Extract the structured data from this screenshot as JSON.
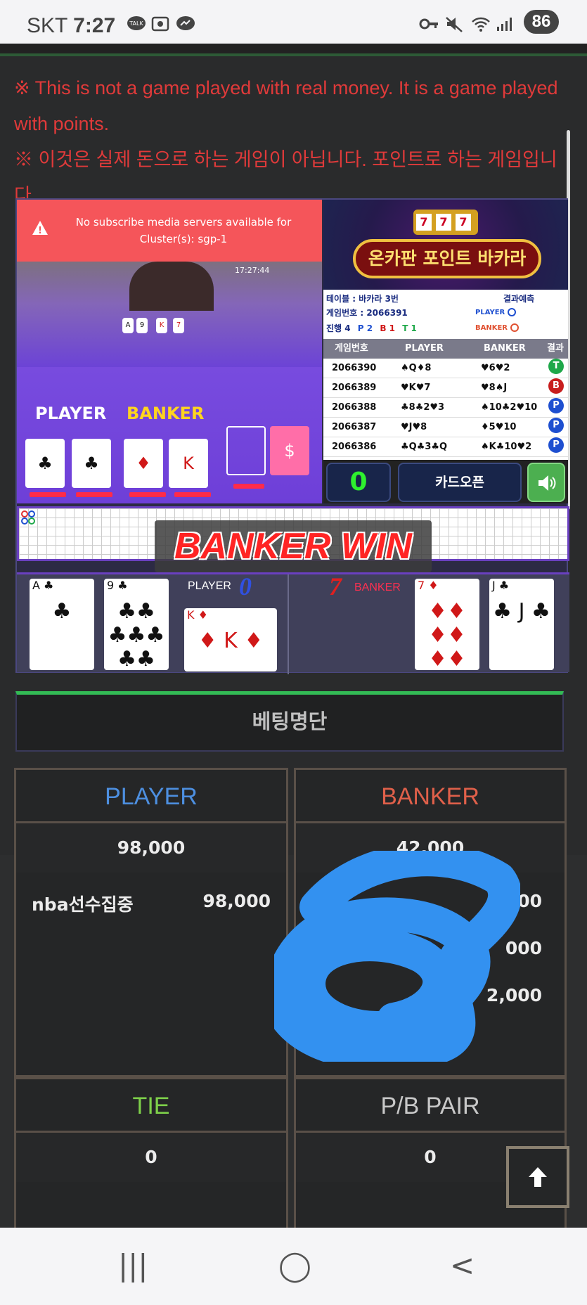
{
  "status_bar": {
    "carrier": "SKT",
    "time": "7:27",
    "battery": "86",
    "left_icons": [
      "talk-icon",
      "screenshot-icon",
      "messenger-icon"
    ],
    "right_icons": [
      "vpn-key-icon",
      "mute-icon",
      "wifi-icon",
      "signal-icon"
    ]
  },
  "notice": {
    "line_en": "※ This is not a game played with real money. It is a game played with points.",
    "line_ko": "※ 이것은 실제 돈으로 하는 게임이 아닙니다. 포인트로 하는 게임입니다."
  },
  "video": {
    "alert": "No subscribe media servers available for Cluster(s): sgp-1",
    "clock": "17:27:44",
    "player_label": "PLAYER",
    "banker_label": "BANKER",
    "table_colors": {
      "felt": "#6e3fd8",
      "stake_red": "#ff2b4a"
    }
  },
  "info_panel": {
    "title": "온카판 포인트 바카라",
    "slot_symbols": [
      "7",
      "7",
      "7"
    ],
    "table_line": "테이블 : 바카라 3번",
    "prediction_label": "결과예측",
    "game_no_line": "게임번호 : 2066391",
    "progress_label": "진행 4",
    "progress_p": "P 2",
    "progress_b": "B 1",
    "progress_t": "T 1",
    "pred_player": "PLAYER",
    "pred_banker": "BANKER",
    "history_headers": [
      "게임번호",
      "PLAYER",
      "BANKER",
      "결과"
    ],
    "history": [
      {
        "id": "2066390",
        "player": "♠Q♦8",
        "banker": "♥6♥2",
        "result": "T",
        "color": "#1fa84a"
      },
      {
        "id": "2066389",
        "player": "♥K♥7",
        "banker": "♥8♠J",
        "result": "B",
        "color": "#c81e1e"
      },
      {
        "id": "2066388",
        "player": "♣8♣2♥3",
        "banker": "♠10♣2♥10",
        "result": "P",
        "color": "#1e4fd0"
      },
      {
        "id": "2066387",
        "player": "♥J♥8",
        "banker": "♦5♥10",
        "result": "P",
        "color": "#1e4fd0"
      },
      {
        "id": "2066386",
        "player": "♣Q♣3♣Q",
        "banker": "♠K♣10♥2",
        "result": "P",
        "color": "#1e4fd0"
      }
    ],
    "counter": "0",
    "card_open_label": "카드오픈",
    "sound_icon": "speaker-icon"
  },
  "result": {
    "win_text": "BANKER WIN",
    "player_label": "PLAYER",
    "player_score": "0",
    "banker_label": "BANKER",
    "banker_score": "7",
    "player_cards": [
      {
        "rank": "A",
        "suit": "♣",
        "pips": "♣"
      },
      {
        "rank": "9",
        "suit": "♣",
        "pips": "♣♣\n♣♣♣\n♣♣"
      },
      {
        "rank": "K",
        "suit": "♦",
        "pips": "♦ K ♦"
      }
    ],
    "banker_cards": [
      {
        "rank": "7",
        "suit": "♦",
        "pips": "♦♦\n♦♦\n♦♦"
      },
      {
        "rank": "J",
        "suit": "♣",
        "pips": "♣ J ♣"
      }
    ]
  },
  "bet_list": {
    "heading": "베팅명단",
    "player": {
      "title": "PLAYER",
      "title_color": "#4d8fe0",
      "total": "98,000",
      "entries": [
        {
          "name": "nba선수집중",
          "amount": "98,000"
        }
      ]
    },
    "banker": {
      "title": "BANKER",
      "title_color": "#e0604a",
      "total": "42,000",
      "entries": [
        {
          "name": "",
          "amount": "000"
        },
        {
          "name": "",
          "amount": "000"
        },
        {
          "name": "",
          "amount": "2,000"
        }
      ]
    },
    "tie": {
      "title": "TIE",
      "title_color": "#7ed04a",
      "total": "0"
    },
    "pair": {
      "title": "P/B PAIR",
      "title_color": "#c8c8c8",
      "total": "0"
    }
  },
  "scroll_top_icon": "arrow-up-icon",
  "navbar": {
    "recent": "|||",
    "home": "◯",
    "back": "<"
  }
}
